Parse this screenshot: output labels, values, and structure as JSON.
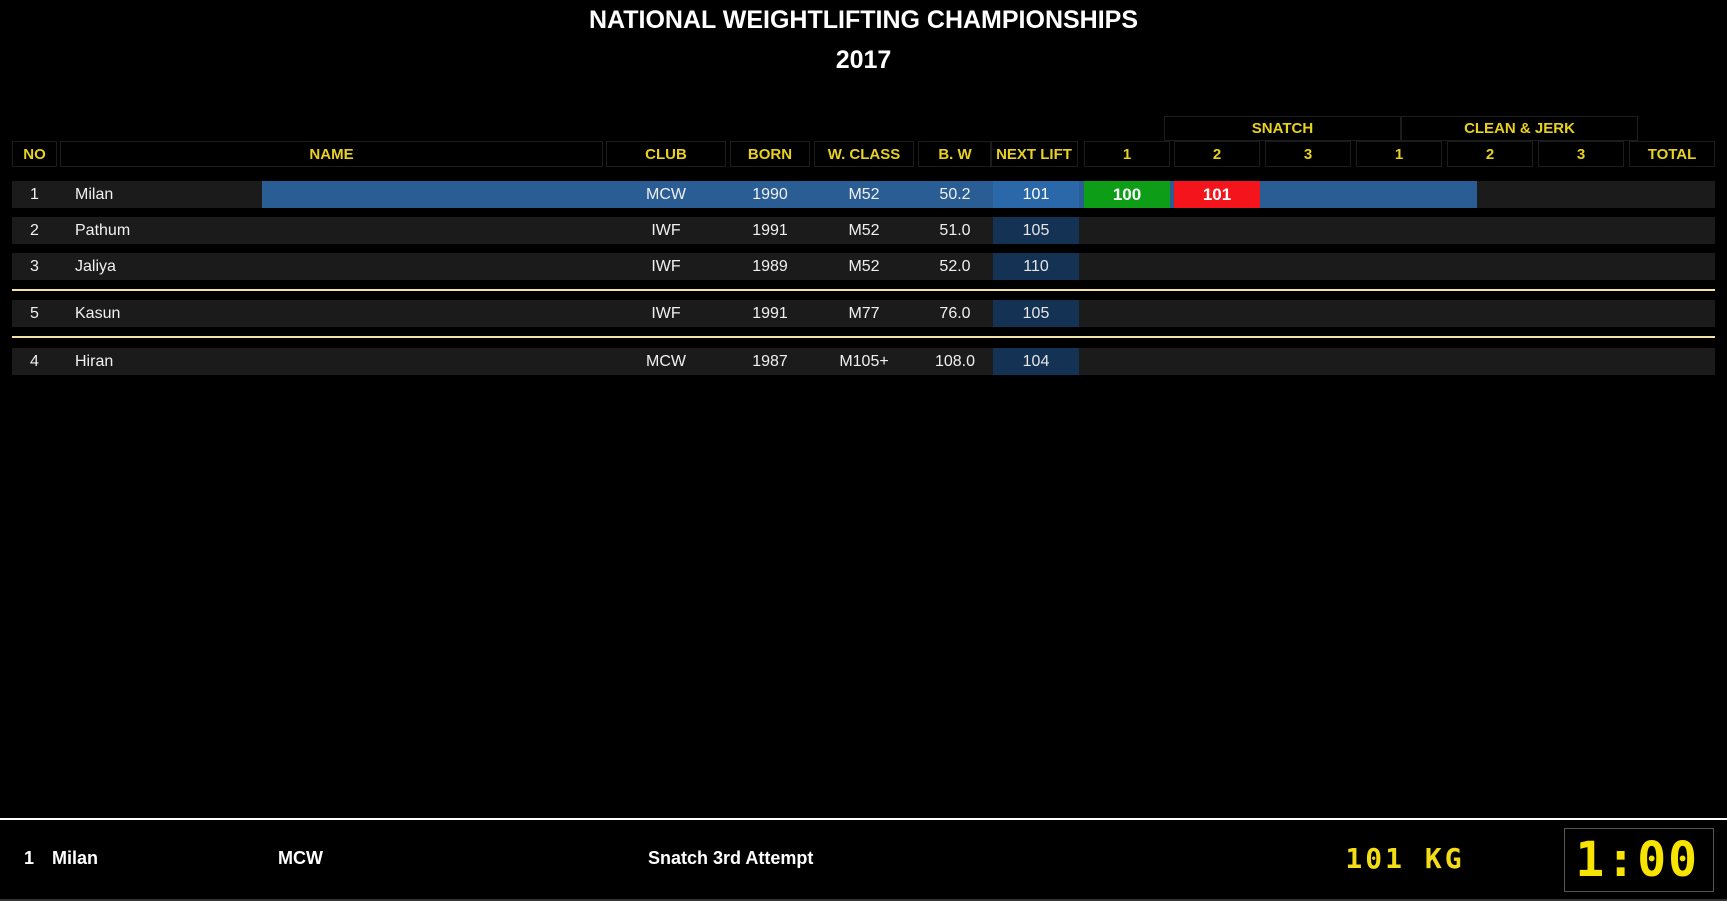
{
  "title": "NATIONAL WEIGHTLIFTING CHAMPIONSHIPS",
  "year": "2017",
  "groups": {
    "snatch": "SNATCH",
    "clean_jerk": "CLEAN & JERK"
  },
  "headers": {
    "no": "NO",
    "name": "NAME",
    "club": "CLUB",
    "born": "BORN",
    "wclass": "W. CLASS",
    "bw": "B. W",
    "next_lift": "NEXT LIFT",
    "s1": "1",
    "s2": "2",
    "s3": "3",
    "c1": "1",
    "c2": "2",
    "c3": "3",
    "total": "TOTAL"
  },
  "athletes": [
    {
      "no": "1",
      "name": "Milan",
      "club": "MCW",
      "born": "1990",
      "wclass": "M52",
      "bw": "50.2",
      "next": "101",
      "snatch": [
        {
          "value": "100",
          "result": "good"
        },
        {
          "value": "101",
          "result": "bad"
        },
        {
          "value": "",
          "result": "none"
        }
      ],
      "active": true
    },
    {
      "no": "2",
      "name": "Pathum",
      "club": "IWF",
      "born": "1991",
      "wclass": "M52",
      "bw": "51.0",
      "next": "105",
      "snatch": [
        {
          "value": "",
          "result": "none"
        },
        {
          "value": "",
          "result": "none"
        },
        {
          "value": "",
          "result": "none"
        }
      ],
      "active": false
    },
    {
      "no": "3",
      "name": "Jaliya",
      "club": "IWF",
      "born": "1989",
      "wclass": "M52",
      "bw": "52.0",
      "next": "110",
      "snatch": [
        {
          "value": "",
          "result": "none"
        },
        {
          "value": "",
          "result": "none"
        },
        {
          "value": "",
          "result": "none"
        }
      ],
      "active": false
    },
    {
      "no": "5",
      "name": "Kasun",
      "club": "IWF",
      "born": "1991",
      "wclass": "M77",
      "bw": "76.0",
      "next": "105",
      "snatch": [
        {
          "value": "",
          "result": "none"
        },
        {
          "value": "",
          "result": "none"
        },
        {
          "value": "",
          "result": "none"
        }
      ],
      "active": false
    },
    {
      "no": "4",
      "name": "Hiran",
      "club": "MCW",
      "born": "1987",
      "wclass": "M105+",
      "bw": "108.0",
      "next": "104",
      "snatch": [
        {
          "value": "",
          "result": "none"
        },
        {
          "value": "",
          "result": "none"
        },
        {
          "value": "",
          "result": "none"
        }
      ],
      "active": false
    }
  ],
  "footer": {
    "no": "1",
    "name": "Milan",
    "club": "MCW",
    "attempt": "Snatch 3rd Attempt",
    "weight": "101 KG",
    "timer": "1:00"
  },
  "colors": {
    "header_text": "#e8d11f",
    "active_row": "#2a5d94",
    "next_lift_bg": "#133254",
    "good_lift": "#0e9d17",
    "bad_lift": "#f4141c",
    "divider": "#f2e2a5",
    "timer": "#f7e400"
  }
}
